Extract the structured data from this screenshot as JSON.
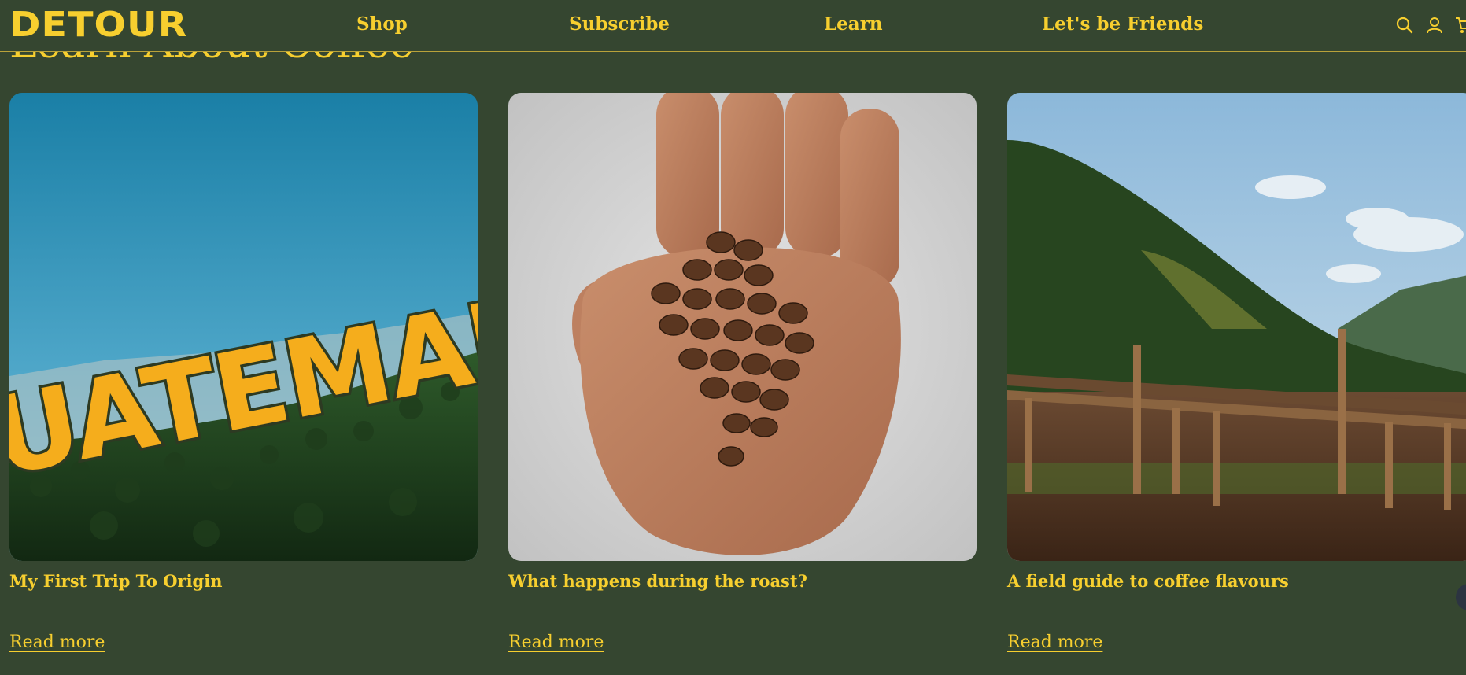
{
  "header": {
    "logo": "DETOUR",
    "nav": [
      {
        "label": "Shop"
      },
      {
        "label": "Subscribe"
      },
      {
        "label": "Learn"
      },
      {
        "label": "Let's be Friends"
      }
    ],
    "icons": [
      "search-icon",
      "account-icon",
      "cart-icon"
    ]
  },
  "section": {
    "title": "Learn About Coffee"
  },
  "cards": [
    {
      "title": "My First Trip To Origin",
      "link": "Read more",
      "image_text": "UATEMAL"
    },
    {
      "title": "What happens during the roast?",
      "link": "Read more"
    },
    {
      "title": "A field guide to coffee flavours",
      "link": "Read more"
    }
  ],
  "colors": {
    "background": "#354630",
    "accent": "#f7cf2f",
    "divider": "#b9a23a"
  }
}
